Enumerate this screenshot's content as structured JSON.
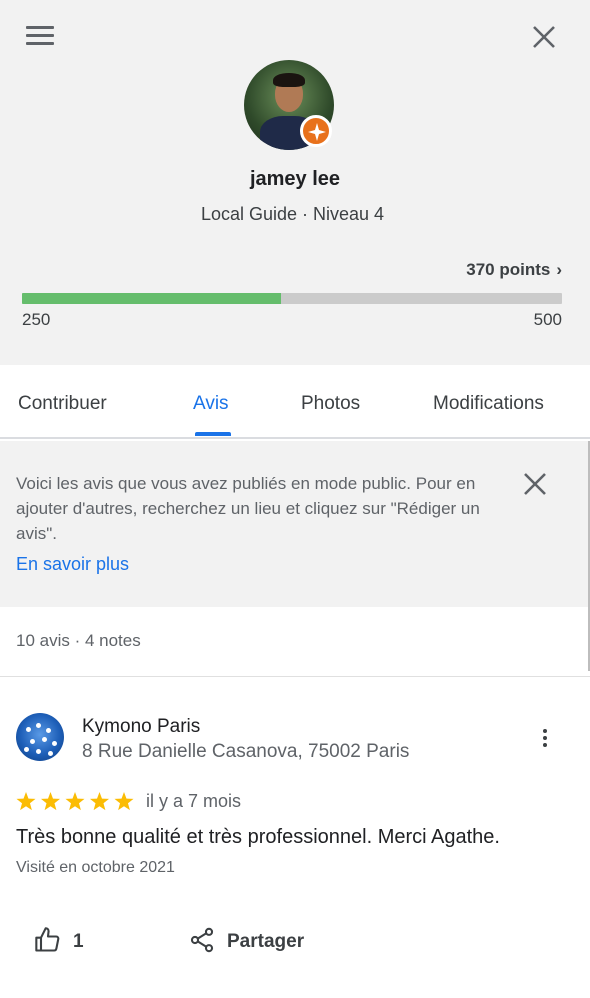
{
  "profile": {
    "name": "jamey lee",
    "level": "Local Guide · Niveau 4",
    "points_label": "370 points",
    "progress_min": "250",
    "progress_max": "500",
    "progress_fraction": 0.48
  },
  "tabs": [
    {
      "label": "Contribuer",
      "active": false
    },
    {
      "label": "Avis",
      "active": true
    },
    {
      "label": "Photos",
      "active": false
    },
    {
      "label": "Modifications",
      "active": false
    }
  ],
  "notice": {
    "text": "Voici les avis que vous avez publiés en mode public. Pour en ajouter d'autres, recherchez un lieu et cliquez sur \"Rédiger un avis\".",
    "link": "En savoir plus"
  },
  "counts": "10 avis · 4 notes",
  "review": {
    "place_name": "Kymono Paris",
    "place_address": "8 Rue Danielle Casanova, 75002 Paris",
    "rating": 5,
    "time_ago": "il y a 7 mois",
    "text": "Très bonne qualité et très professionnel. Merci Agathe.",
    "visited": "Visité en octobre 2021",
    "likes": "1",
    "share_label": "Partager"
  },
  "colors": {
    "accent": "#1a73e8",
    "progress_fill": "#65bd6c",
    "progress_track": "#cbcbcb",
    "badge": "#e8711c",
    "star": "#fbbc04"
  }
}
